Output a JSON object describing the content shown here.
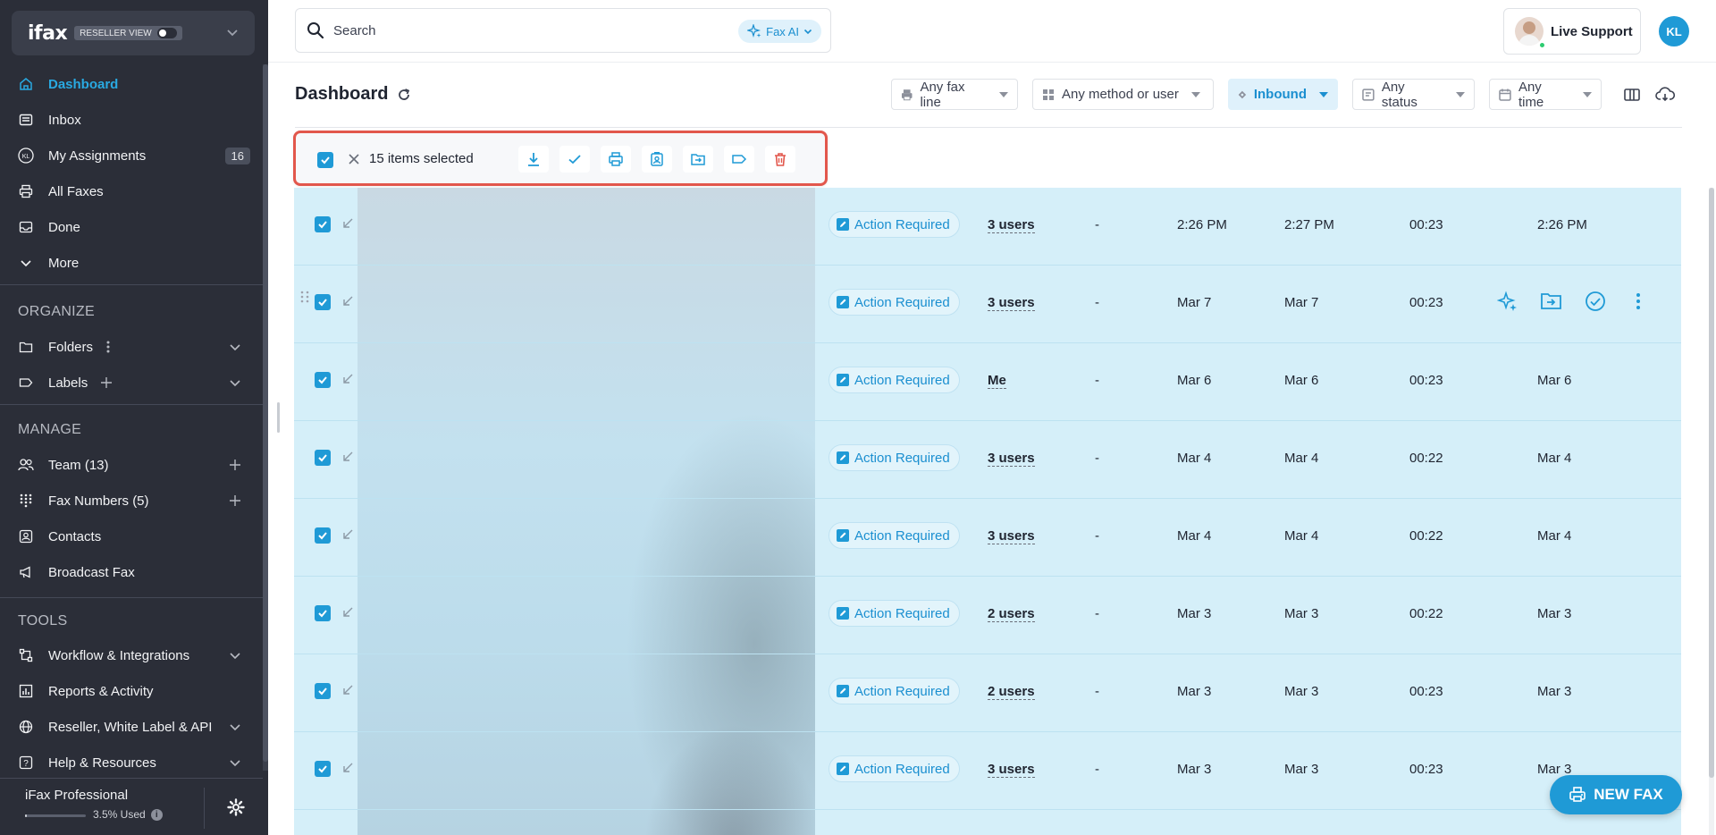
{
  "sidebar": {
    "brand": {
      "logo": "ifax",
      "reseller_label": "RESELLER VIEW"
    },
    "nav": [
      {
        "label": "Dashboard",
        "icon": "home-icon",
        "active": true
      },
      {
        "label": "Inbox",
        "icon": "inbox-icon"
      },
      {
        "label": "My Assignments",
        "icon": "avatar-kl-icon",
        "badge": "16"
      },
      {
        "label": "All Faxes",
        "icon": "printer-icon"
      },
      {
        "label": "Done",
        "icon": "done-tray-icon"
      },
      {
        "label": "More",
        "icon": "chevron-down-icon"
      }
    ],
    "organize": {
      "title": "ORGANIZE",
      "items": [
        {
          "label": "Folders",
          "icon": "folder-icon"
        },
        {
          "label": "Labels",
          "icon": "label-icon"
        }
      ]
    },
    "manage": {
      "title": "MANAGE",
      "items": [
        {
          "label": "Team (13)",
          "icon": "team-icon"
        },
        {
          "label": "Fax Numbers (5)",
          "icon": "keypad-icon"
        },
        {
          "label": "Contacts",
          "icon": "contacts-icon"
        },
        {
          "label": "Broadcast Fax",
          "icon": "megaphone-icon"
        }
      ]
    },
    "tools": {
      "title": "TOOLS",
      "items": [
        {
          "label": "Workflow & Integrations",
          "icon": "workflow-icon"
        },
        {
          "label": "Reports & Activity",
          "icon": "chart-icon"
        },
        {
          "label": "Reseller, White Label & API",
          "icon": "globe-icon"
        },
        {
          "label": "Help & Resources",
          "icon": "help-icon"
        }
      ]
    },
    "footer": {
      "plan": "iFax Professional",
      "usage": "3.5% Used",
      "usage_fraction": 0.035
    }
  },
  "topbar": {
    "search_placeholder": "Search",
    "fax_ai": "Fax AI",
    "live_support": "Live Support",
    "user_initials": "KL"
  },
  "header": {
    "title": "Dashboard",
    "filters": {
      "line": "Any fax line",
      "method": "Any method or user",
      "direction": "Inbound",
      "status": "Any status",
      "time": "Any time"
    }
  },
  "selection": {
    "count_label": "15 items selected"
  },
  "table": {
    "rows": [
      {
        "status": "Action Required",
        "users": "3 users",
        "dash": "-",
        "c1": "2:26 PM",
        "c2": "2:27 PM",
        "duration": "00:23",
        "c4": "2:26 PM"
      },
      {
        "status": "Action Required",
        "users": "3 users",
        "dash": "-",
        "c1": "Mar 7",
        "c2": "Mar 7",
        "duration": "00:23",
        "c4": ""
      },
      {
        "status": "Action Required",
        "users": "Me",
        "dash": "-",
        "c1": "Mar 6",
        "c2": "Mar 6",
        "duration": "00:23",
        "c4": "Mar 6"
      },
      {
        "status": "Action Required",
        "users": "3 users",
        "dash": "-",
        "c1": "Mar 4",
        "c2": "Mar 4",
        "duration": "00:22",
        "c4": "Mar 4"
      },
      {
        "status": "Action Required",
        "users": "3 users",
        "dash": "-",
        "c1": "Mar 4",
        "c2": "Mar 4",
        "duration": "00:22",
        "c4": "Mar 4"
      },
      {
        "status": "Action Required",
        "users": "2 users",
        "dash": "-",
        "c1": "Mar 3",
        "c2": "Mar 3",
        "duration": "00:22",
        "c4": "Mar 3"
      },
      {
        "status": "Action Required",
        "users": "2 users",
        "dash": "-",
        "c1": "Mar 3",
        "c2": "Mar 3",
        "duration": "00:23",
        "c4": "Mar 3"
      },
      {
        "status": "Action Required",
        "users": "3 users",
        "dash": "-",
        "c1": "Mar 3",
        "c2": "Mar 3",
        "duration": "00:23",
        "c4": "Mar 3"
      }
    ]
  },
  "new_fax": "NEW FAX",
  "colors": {
    "accent": "#1f9ad6",
    "sidebar_bg": "#2b2e38",
    "selection_border": "#e2574c",
    "row_bg": "#d5eff9",
    "delete": "#e2574c"
  }
}
